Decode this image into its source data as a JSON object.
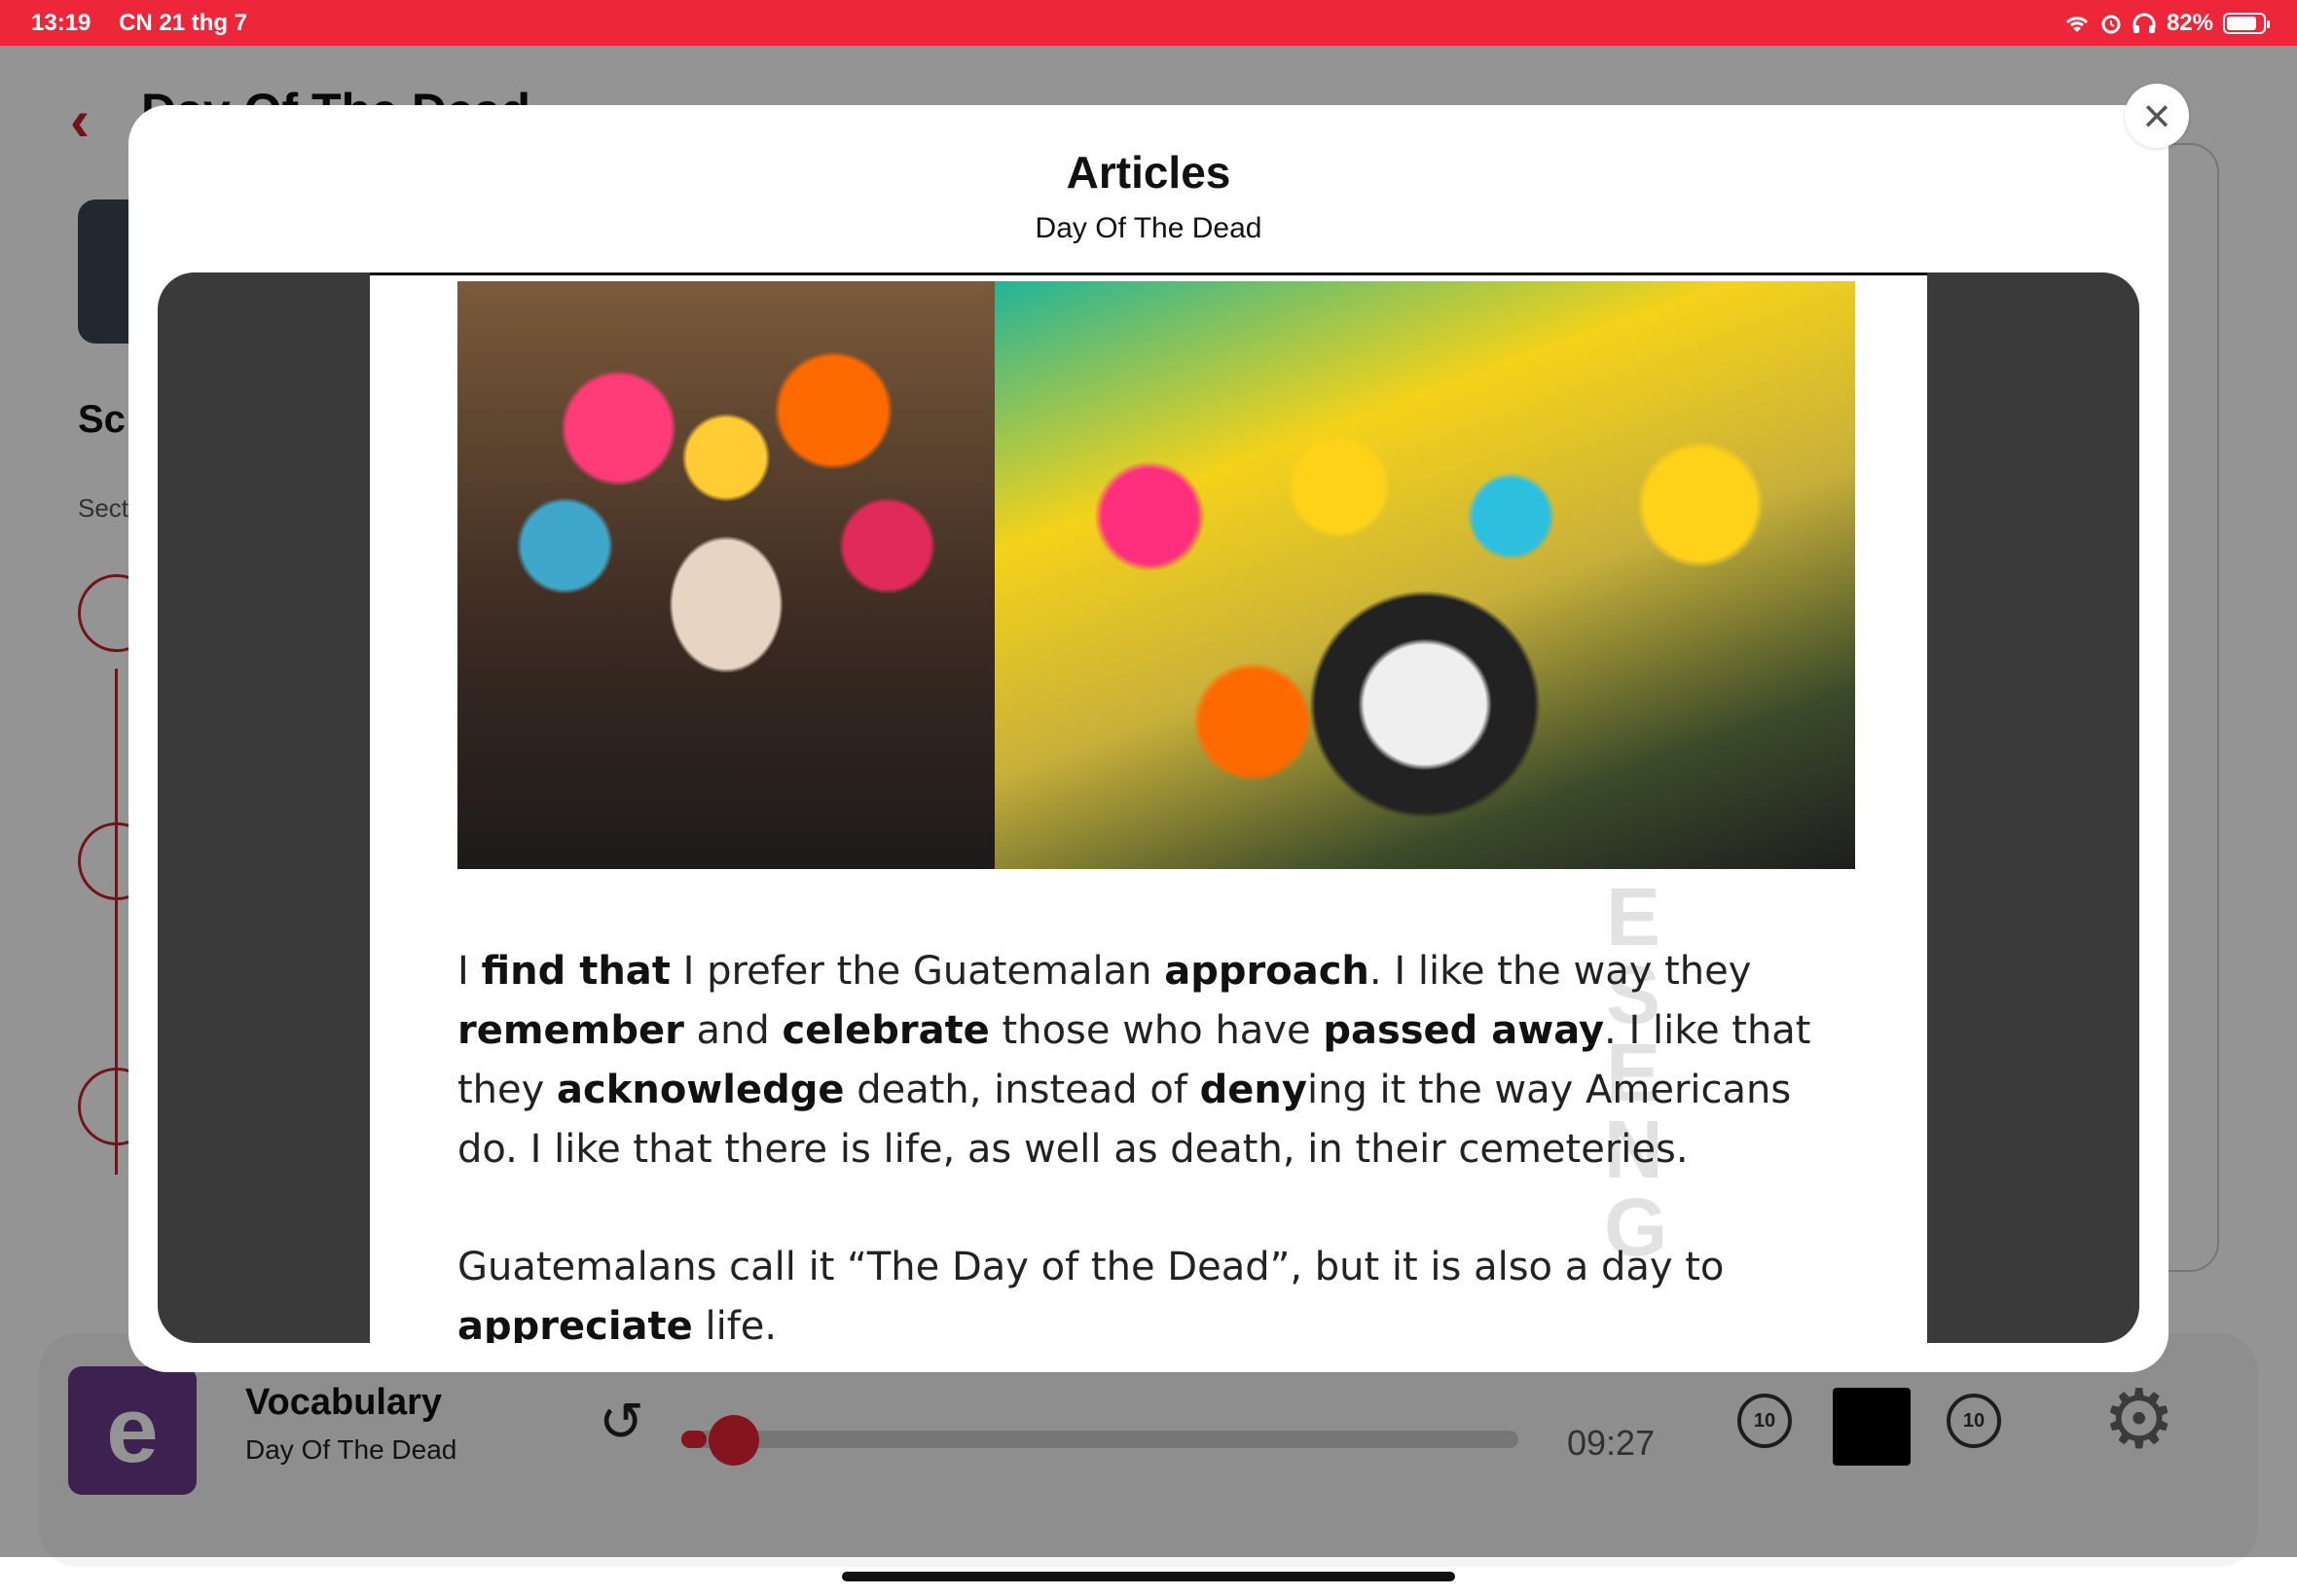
{
  "status_bar": {
    "time": "13:19",
    "date": "CN 21 thg 7",
    "battery": "82%",
    "icons": [
      "wifi-icon",
      "alarm-icon",
      "headphones-icon",
      "battery-icon"
    ]
  },
  "background": {
    "title": "Day Of The Dead",
    "section_title": "Sc",
    "section_label": "Sect"
  },
  "modal": {
    "title": "Articles",
    "subtitle": "Day Of The Dead",
    "watermark": "ESENG",
    "article": [
      [
        {
          "t": "I "
        },
        {
          "t": "find that",
          "b": true
        },
        {
          "t": " I prefer the Guatemalan "
        },
        {
          "t": "approach",
          "b": true
        },
        {
          "t": ". I like the way they "
        },
        {
          "t": "remember",
          "b": true
        },
        {
          "t": " and "
        },
        {
          "t": "celebrate",
          "b": true
        },
        {
          "t": " those who have "
        },
        {
          "t": "passed away",
          "b": true
        },
        {
          "t": ". I like that they "
        },
        {
          "t": "acknowledge",
          "b": true
        },
        {
          "t": " death, instead of "
        },
        {
          "t": "deny",
          "b": true
        },
        {
          "t": "ing it the way Americans do. I like that there is life, as well as death, in their cemeteries."
        }
      ],
      [
        {
          "t": "Guatemalans call it “The Day of the Dead”, but it is also a day to "
        },
        {
          "t": "appreciate",
          "b": true
        },
        {
          "t": " life."
        }
      ]
    ]
  },
  "player": {
    "title": "Vocabulary",
    "subtitle": "Day Of The Dead",
    "time": "09:27",
    "progress": 0.03,
    "rewind_label": "10",
    "forward_label": "10",
    "logo_glyph": "e"
  }
}
